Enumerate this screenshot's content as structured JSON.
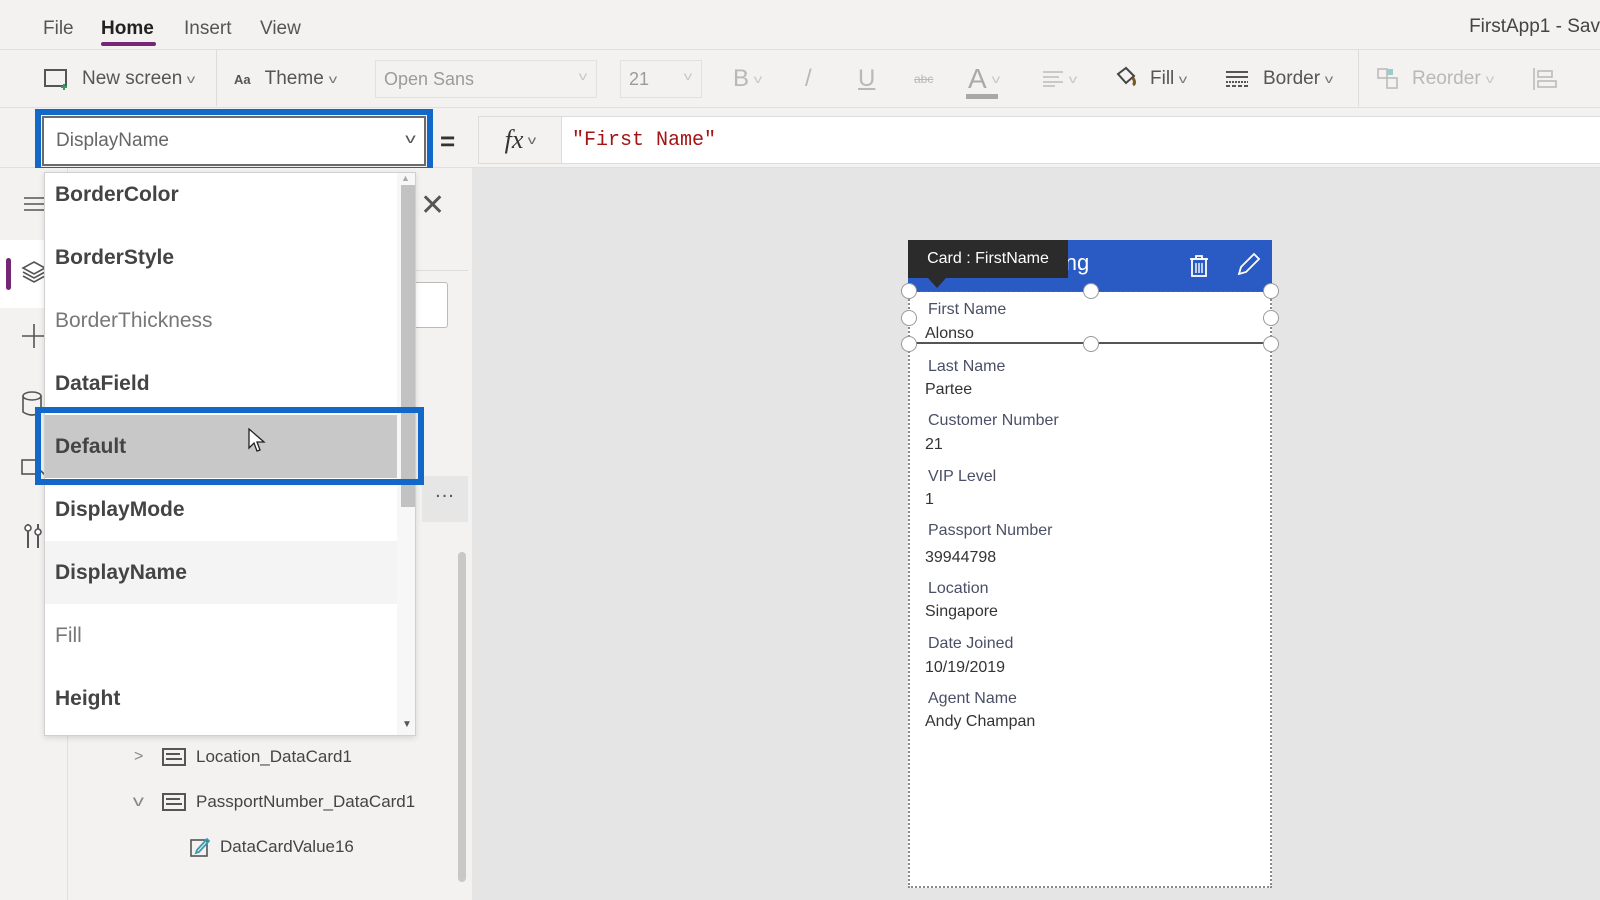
{
  "menu": {
    "items": [
      {
        "label": "File"
      },
      {
        "label": "Home",
        "active": true
      },
      {
        "label": "Insert"
      },
      {
        "label": "View"
      }
    ],
    "app_title": "FirstApp1 - Sav"
  },
  "ribbon": {
    "new_screen": "New screen",
    "theme": "Theme",
    "font_family": "Open Sans",
    "font_size": "21",
    "bold": "B",
    "italic": "/",
    "underline": "U",
    "strikethrough": "abc",
    "font_color": "A",
    "fill": "Fill",
    "border": "Border",
    "reorder": "Reorder"
  },
  "formula_bar": {
    "property": "DisplayName",
    "equals": "=",
    "fx": "fx",
    "formula": "\"First Name\""
  },
  "property_dropdown": {
    "items": [
      {
        "label": "BorderColor",
        "style": "bold"
      },
      {
        "label": "BorderStyle",
        "style": "bold"
      },
      {
        "label": "BorderThickness",
        "style": "light"
      },
      {
        "label": "DataField",
        "style": "bold"
      },
      {
        "label": "Default",
        "style": "bold",
        "state": "selected"
      },
      {
        "label": "DisplayMode",
        "style": "bold"
      },
      {
        "label": "DisplayName",
        "style": "bold",
        "state": "current"
      },
      {
        "label": "Fill",
        "style": "light"
      },
      {
        "label": "Height",
        "style": "bold"
      }
    ]
  },
  "tree_view": {
    "more_label": "...",
    "rows": [
      {
        "label": "Location_DataCard1",
        "expanded": false
      },
      {
        "label": "PassportNumber_DataCard1",
        "expanded": true
      },
      {
        "label": "DataCardValue16"
      }
    ]
  },
  "canvas": {
    "tooltip": "Card : FirstName",
    "header_title_partial": "ling",
    "fields": [
      {
        "label": "First Name",
        "value": "Alonso"
      },
      {
        "label": "Last Name",
        "value": "Partee"
      },
      {
        "label": "Customer Number",
        "value": "21"
      },
      {
        "label": "VIP Level",
        "value": "1"
      },
      {
        "label": "Passport Number",
        "value": "39944798"
      },
      {
        "label": "Location",
        "value": "Singapore"
      },
      {
        "label": "Date Joined",
        "value": "10/19/2019"
      },
      {
        "label": "Agent Name",
        "value": "Andy Champan"
      }
    ]
  },
  "colors": {
    "accent_purple": "#742774",
    "highlight_blue": "#1168c8",
    "header_blue": "#2a5ac4",
    "formula_string": "#a31515"
  }
}
